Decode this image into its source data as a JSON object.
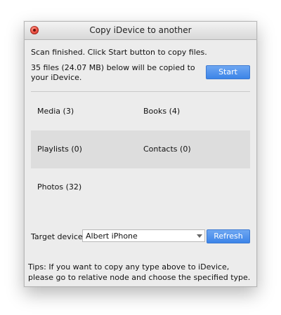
{
  "window": {
    "title": "Copy iDevice to another",
    "status_line": "Scan finished. Click Start button to copy files.",
    "summary_line": "35 files (24.07 MB) below will be copied to your iDevice.",
    "start_label": "Start",
    "categories": [
      {
        "left": "Media (3)",
        "right": "Books (4)"
      },
      {
        "left": "Playlists (0)",
        "right": "Contacts (0)"
      },
      {
        "left": "Photos (32)",
        "right": ""
      }
    ],
    "target_label": "Target device:",
    "target_value": "Albert iPhone",
    "refresh_label": "Refresh",
    "tips": "Tips: If you want to copy any type above to iDevice, please go to relative node and choose the specified type."
  },
  "colors": {
    "accent_button": "#3c84e8",
    "close_button": "#f2574b",
    "row_shade": "#dddddd"
  },
  "icons": {
    "close": "close-icon",
    "dropdown": "chevron-down-icon"
  }
}
